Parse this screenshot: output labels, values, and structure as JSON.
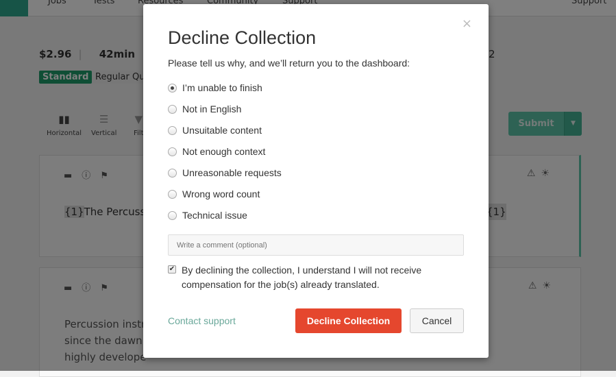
{
  "nav": {
    "items": [
      "Jobs",
      "Tests",
      "Resources",
      "Community",
      "Support"
    ],
    "right": "Support"
  },
  "job": {
    "price": "$2.96",
    "time": "42min",
    "right_number": "2",
    "tier": "Standard",
    "quality": "Regular Qu"
  },
  "toolbar": {
    "horizontal": "Horizontal",
    "vertical": "Vertical",
    "filter": "Filt",
    "submit": "Submit"
  },
  "cards": [
    {
      "text_tag": "{1}",
      "text": "The Percuss",
      "end_tag": "{1}"
    },
    {
      "lines": [
        "Percussion instr",
        "since the dawn",
        "highly develope"
      ]
    }
  ],
  "modal": {
    "title": "Decline Collection",
    "subtitle": "Please tell us why, and we’ll return you to the dashboard:",
    "options": [
      "I’m unable to finish",
      "Not in English",
      "Unsuitable content",
      "Not enough context",
      "Unreasonable requests",
      "Wrong word count",
      "Technical issue"
    ],
    "selected": "I’m unable to finish",
    "comment_placeholder": "Write a comment (optional)",
    "confirm_checked": true,
    "confirm_text": "By declining the collection, I understand I will not receive compensation for the job(s) already translated.",
    "contact": "Contact support",
    "decline": "Decline Collection",
    "cancel": "Cancel",
    "close": "×"
  },
  "colors": {
    "accent": "#2fa88e",
    "decline": "#e5472e",
    "badge": "#1e9c6b"
  }
}
